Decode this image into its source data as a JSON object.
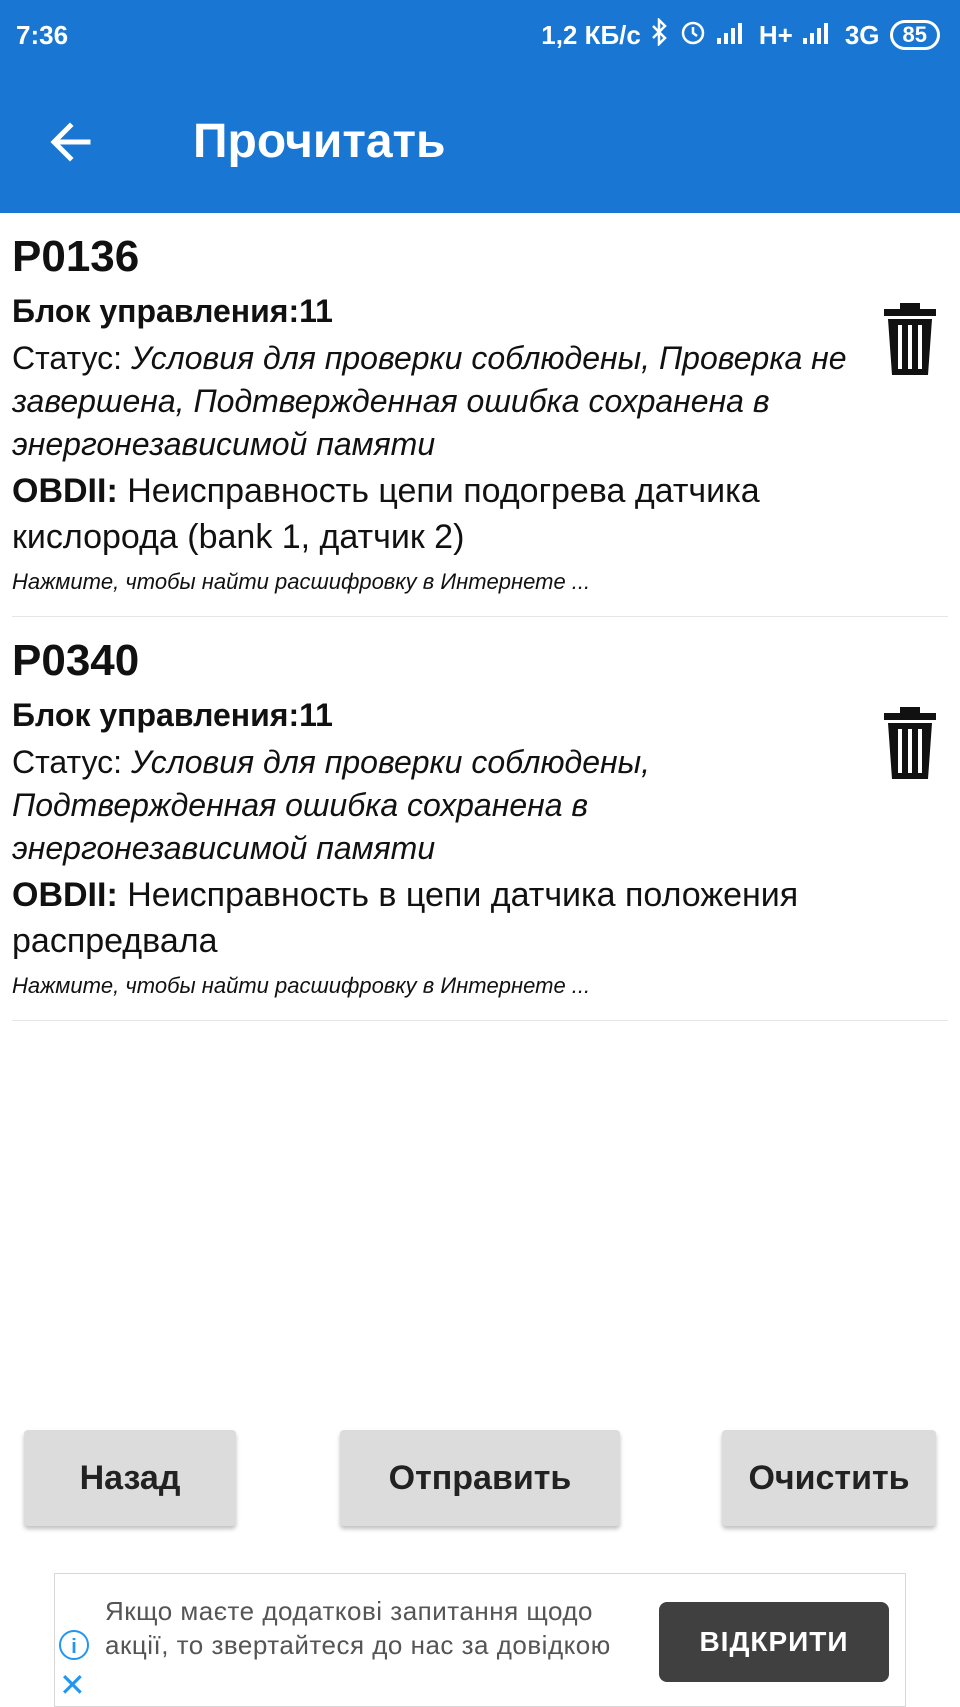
{
  "status_bar": {
    "time": "7:36",
    "speed": "1,2 КБ/с",
    "network1": "H+",
    "network2": "3G",
    "battery": "85"
  },
  "toolbar": {
    "title": "Прочитать"
  },
  "errors": [
    {
      "code": "P0136",
      "block": "Блок управления:11",
      "status_label": "Статус: ",
      "status_value": "Условия для проверки соблюдены, Проверка не завершена, Подтвержденная ошибка сохранена в энергонезависимой памяти",
      "obd_label": "OBDII:",
      "obd_value": " Неисправность цепи подогрева датчика кислорода (bank 1, датчик 2)",
      "hint": "Нажмите, чтобы найти расшифровку в Интернете ..."
    },
    {
      "code": "P0340",
      "block": "Блок управления:11",
      "status_label": "Статус: ",
      "status_value": "Условия для проверки соблюдены, Подтвержденная ошибка сохранена в энергонезависимой памяти",
      "obd_label": "OBDII:",
      "obd_value": " Неисправность в цепи датчика положения распредвала",
      "hint": "Нажмите, чтобы найти расшифровку в Интернете ..."
    }
  ],
  "buttons": {
    "back": "Назад",
    "send": "Отправить",
    "clear": "Очистить"
  },
  "ad": {
    "text": "Якщо маєте додаткові запитання щодо акції, то звертайтеся до нас за довідкою",
    "button": "ВІДКРИТИ"
  },
  "colors": {
    "appbar": "#1976d2",
    "button_bg": "#dcdcdc",
    "ad_button": "#404040",
    "ad_icon": "#2196f3"
  }
}
